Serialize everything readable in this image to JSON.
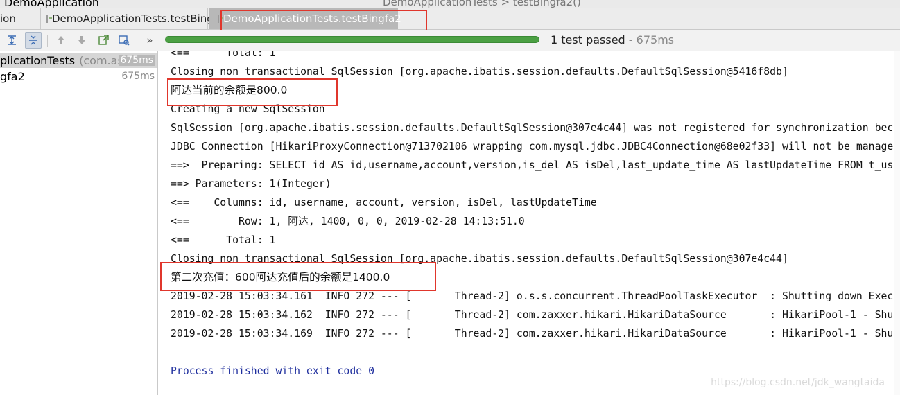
{
  "top_strip": {
    "left_text": "DemoApplication",
    "center_text": "DemoApplicationTests  >  testBingfa2()"
  },
  "tabs": [
    {
      "label": "ion"
    },
    {
      "label": "DemoApplicationTests.testBingfa"
    },
    {
      "label": "DemoApplicationTests.testBingfa2",
      "active": true
    }
  ],
  "toolbar": {
    "buttons": [
      "sort-alpha",
      "sort-duration",
      "previous-failed",
      "next-failed",
      "export",
      "import",
      "more"
    ],
    "more_label": "»"
  },
  "status": {
    "text": "1 test passed",
    "time": " - 675ms",
    "progress_fraction": 1.0,
    "progress_color": "#4ba043"
  },
  "tree": {
    "items": [
      {
        "name": "plicationTests",
        "package": "(com.ashua",
        "time": "675ms"
      },
      {
        "name": "gfa2",
        "package": "",
        "time": "675ms"
      }
    ]
  },
  "console": {
    "lines": [
      "<==      Total: 1",
      "Closing non transactional SqlSession [org.apache.ibatis.session.defaults.DefaultSqlSession@5416f8db]",
      "阿达当前的余额是800.0",
      "Creating a new SqlSession",
      "SqlSession [org.apache.ibatis.session.defaults.DefaultSqlSession@307e4c44] was not registered for synchronization bec",
      "JDBC Connection [HikariProxyConnection@713702106 wrapping com.mysql.jdbc.JDBC4Connection@68e02f33] will not be manage",
      "==>  Preparing: SELECT id AS id,username,account,version,is_del AS isDel,last_update_time AS lastUpdateTime FROM t_us",
      "==> Parameters: 1(Integer)",
      "<==    Columns: id, username, account, version, isDel, lastUpdateTime",
      "<==        Row: 1, 阿达, 1400, 0, 0, 2019-02-28 14:13:51.0",
      "<==      Total: 1",
      "Closing non transactional SqlSession [org.apache.ibatis.session.defaults.DefaultSqlSession@307e4c44]",
      "第二次充值：600阿达充值后的余额是1400.0",
      "2019-02-28 15:03:34.161  INFO 272 --- [       Thread-2] o.s.s.concurrent.ThreadPoolTaskExecutor  : Shutting down Exec",
      "2019-02-28 15:03:34.162  INFO 272 --- [       Thread-2] com.zaxxer.hikari.HikariDataSource       : HikariPool-1 - Shu",
      "2019-02-28 15:03:34.169  INFO 272 --- [       Thread-2] com.zaxxer.hikari.HikariDataSource       : HikariPool-1 - Shu",
      "",
      "Process finished with exit code 0"
    ],
    "watermark": "https://blog.csdn.net/jdk_wangtaida"
  }
}
